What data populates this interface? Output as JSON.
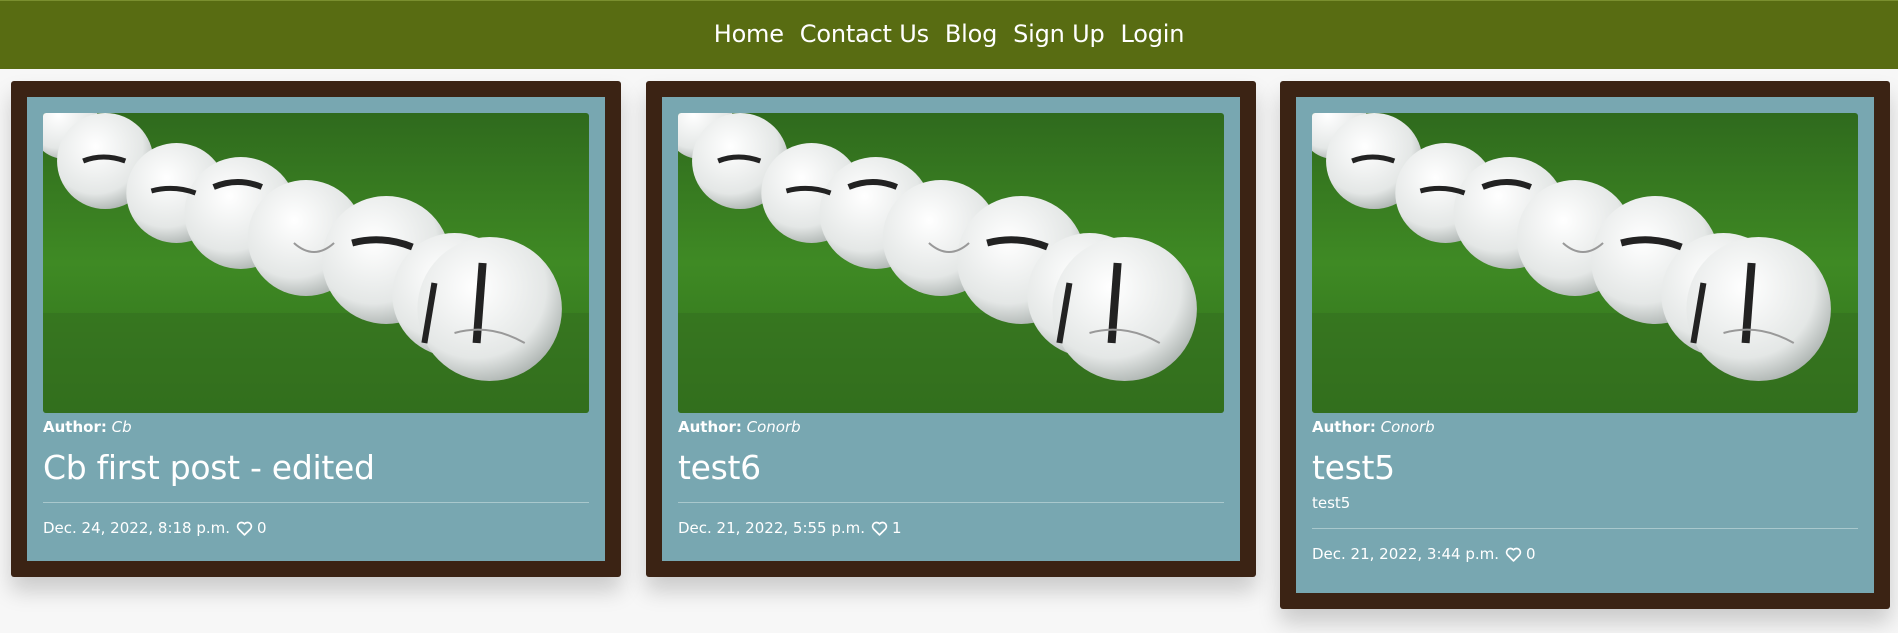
{
  "nav": {
    "items": [
      {
        "label": "Home"
      },
      {
        "label": "Contact Us"
      },
      {
        "label": "Blog"
      },
      {
        "label": "Sign Up"
      },
      {
        "label": "Login"
      }
    ]
  },
  "posts": [
    {
      "author_label": "Author:",
      "author": "Cb",
      "title": "Cb first post - edited",
      "excerpt": "",
      "date": "Dec. 24, 2022, 8:18 p.m.",
      "likes": "0"
    },
    {
      "author_label": "Author:",
      "author": "Conorb",
      "title": "test6",
      "excerpt": "",
      "date": "Dec. 21, 2022, 5:55 p.m.",
      "likes": "1"
    },
    {
      "author_label": "Author:",
      "author": "Conorb",
      "title": "test5",
      "excerpt": "test5",
      "date": "Dec. 21, 2022, 3:44 p.m.",
      "likes": "0"
    }
  ],
  "colors": {
    "navbar": "#586c12",
    "card_frame": "#3b2314",
    "card_body": "#78a7b1"
  },
  "icons": {
    "like": "heart-icon"
  }
}
